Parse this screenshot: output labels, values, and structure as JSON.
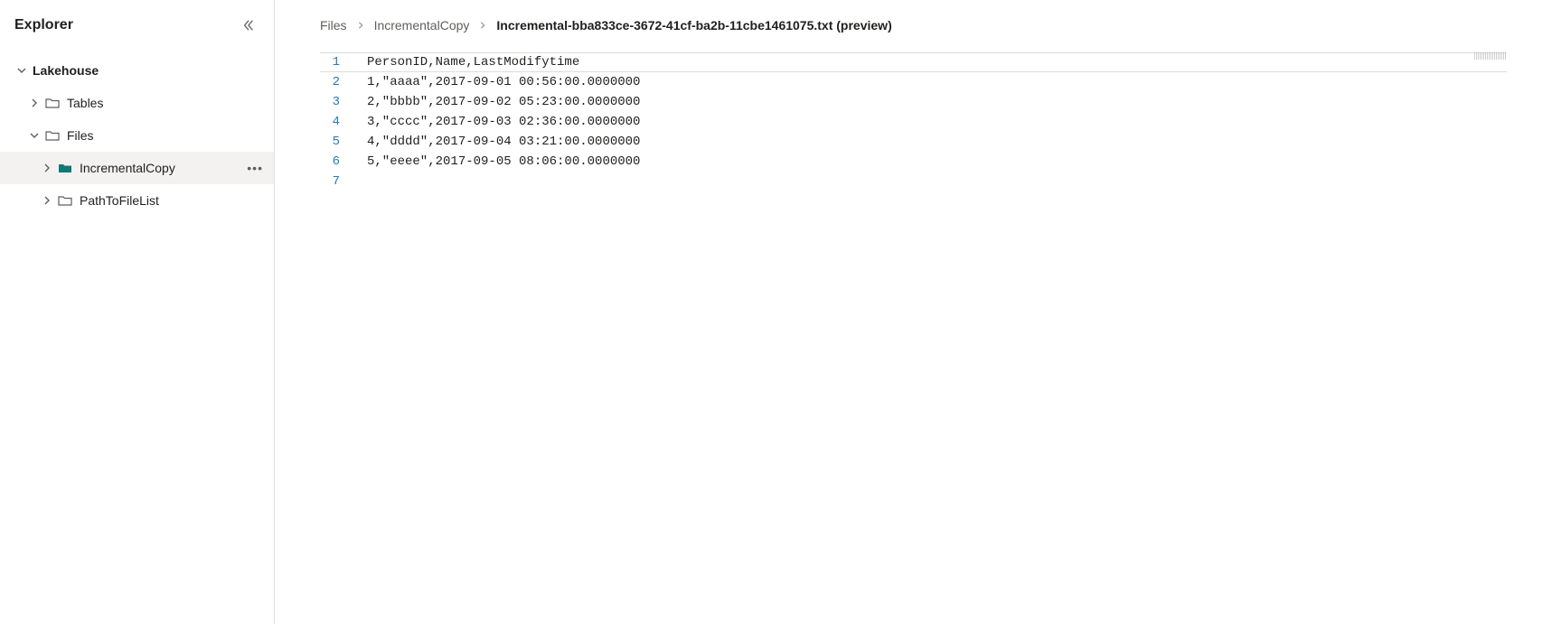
{
  "sidebar": {
    "title": "Explorer",
    "root": {
      "label": "Lakehouse"
    },
    "tables": {
      "label": "Tables"
    },
    "files": {
      "label": "Files"
    },
    "incremental_copy": {
      "label": "IncrementalCopy"
    },
    "path_to_file_list": {
      "label": "PathToFileList"
    }
  },
  "breadcrumb": {
    "item1": "Files",
    "item2": "IncrementalCopy",
    "current": "Incremental-bba833ce-3672-41cf-ba2b-11cbe1461075.txt (preview)"
  },
  "editor": {
    "lines": {
      "n1": "1",
      "n2": "2",
      "n3": "3",
      "n4": "4",
      "n5": "5",
      "n6": "6",
      "n7": "7",
      "l1": "PersonID,Name,LastModifytime",
      "l2": "1,\"aaaa\",2017-09-01 00:56:00.0000000",
      "l3": "2,\"bbbb\",2017-09-02 05:23:00.0000000",
      "l4": "3,\"cccc\",2017-09-03 02:36:00.0000000",
      "l5": "4,\"dddd\",2017-09-04 03:21:00.0000000",
      "l6": "5,\"eeee\",2017-09-05 08:06:00.0000000",
      "l7": ""
    }
  }
}
